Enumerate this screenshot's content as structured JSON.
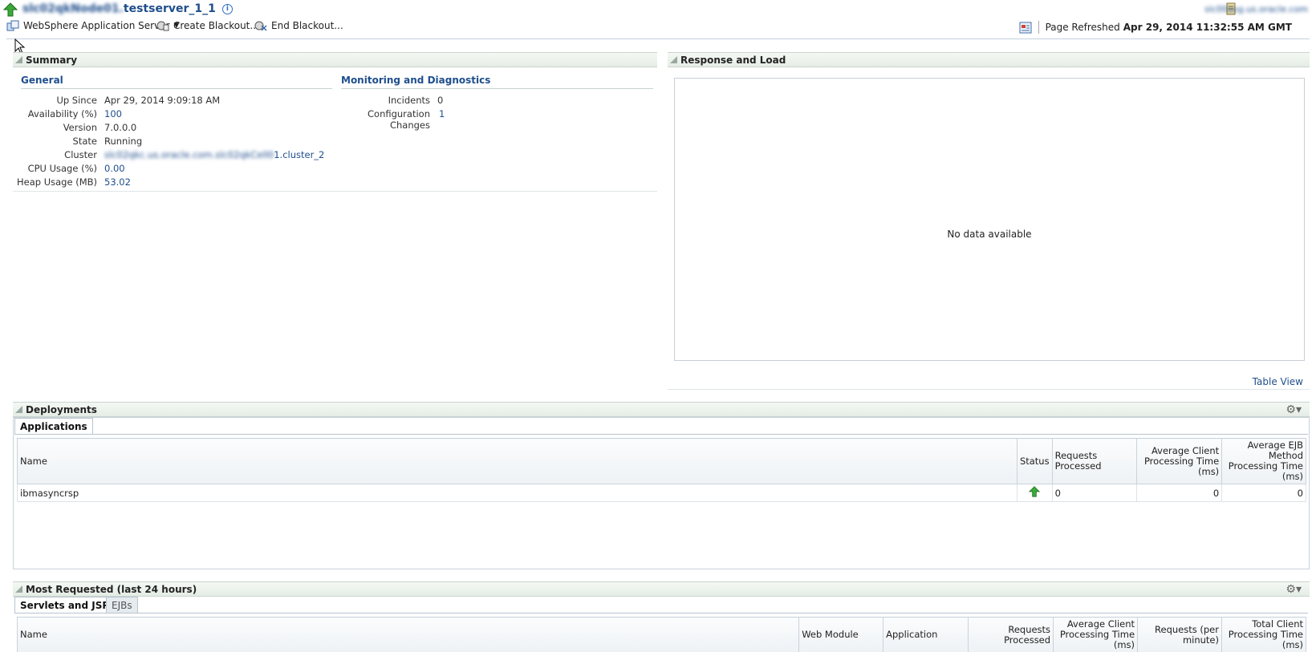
{
  "header": {
    "title_blurred": "slc02qkNode01.",
    "title_suffix": "testserver_1_1",
    "info_icon": "info-icon",
    "host_link": "slc00asg.us.oracle.com"
  },
  "toolbar": {
    "target_menu": "WebSphere Application Server",
    "create_blackout": "Create Blackout...",
    "end_blackout": "End Blackout...",
    "page_refreshed_label": "Page Refreshed",
    "page_refreshed_value": "Apr 29, 2014 11:32:55 AM GMT"
  },
  "summary": {
    "title": "Summary",
    "general": {
      "title": "General",
      "up_since_label": "Up Since",
      "up_since": "Apr 29, 2014 9:09:18 AM",
      "availability_label": "Availability (%)",
      "availability": "100",
      "version_label": "Version",
      "version": "7.0.0.0",
      "state_label": "State",
      "state": "Running",
      "cluster_label": "Cluster",
      "cluster_blurred": "slc02qkc.us.oracle.com.slc02qkCell0",
      "cluster_suffix": "1.cluster_2",
      "cpu_label": "CPU Usage (%)",
      "cpu": "0.00",
      "heap_label": "Heap Usage (MB)",
      "heap": "53.02"
    },
    "monitoring": {
      "title": "Monitoring and Diagnostics",
      "incidents_label": "Incidents",
      "incidents": "0",
      "config_changes_label": "Configuration Changes",
      "config_changes": "1"
    }
  },
  "response": {
    "title": "Response and Load",
    "no_data": "No data available",
    "table_view": "Table View"
  },
  "deployments": {
    "title": "Deployments",
    "tab": "Applications",
    "columns": [
      "Name",
      "Status",
      "Requests Processed",
      "Average Client Processing Time (ms)",
      "Average EJB Method Processing Time (ms)"
    ],
    "rows": [
      {
        "name": "ibmasyncrsp",
        "status": "up",
        "requests": "0",
        "avg_client": "0",
        "avg_ejb": "0"
      }
    ]
  },
  "most_requested": {
    "title": "Most Requested (last 24 hours)",
    "tabs": [
      "Servlets and JSPs",
      "EJBs"
    ],
    "columns": [
      "Name",
      "Web Module",
      "Application",
      "Requests Processed",
      "Average Client Processing Time (ms)",
      "Requests (per minute)",
      "Total Client Processing Time (ms)"
    ]
  },
  "colors": {
    "link": "#1f4e8c",
    "panel_header": "#e5ede6",
    "status_up": "#3aa83a"
  }
}
